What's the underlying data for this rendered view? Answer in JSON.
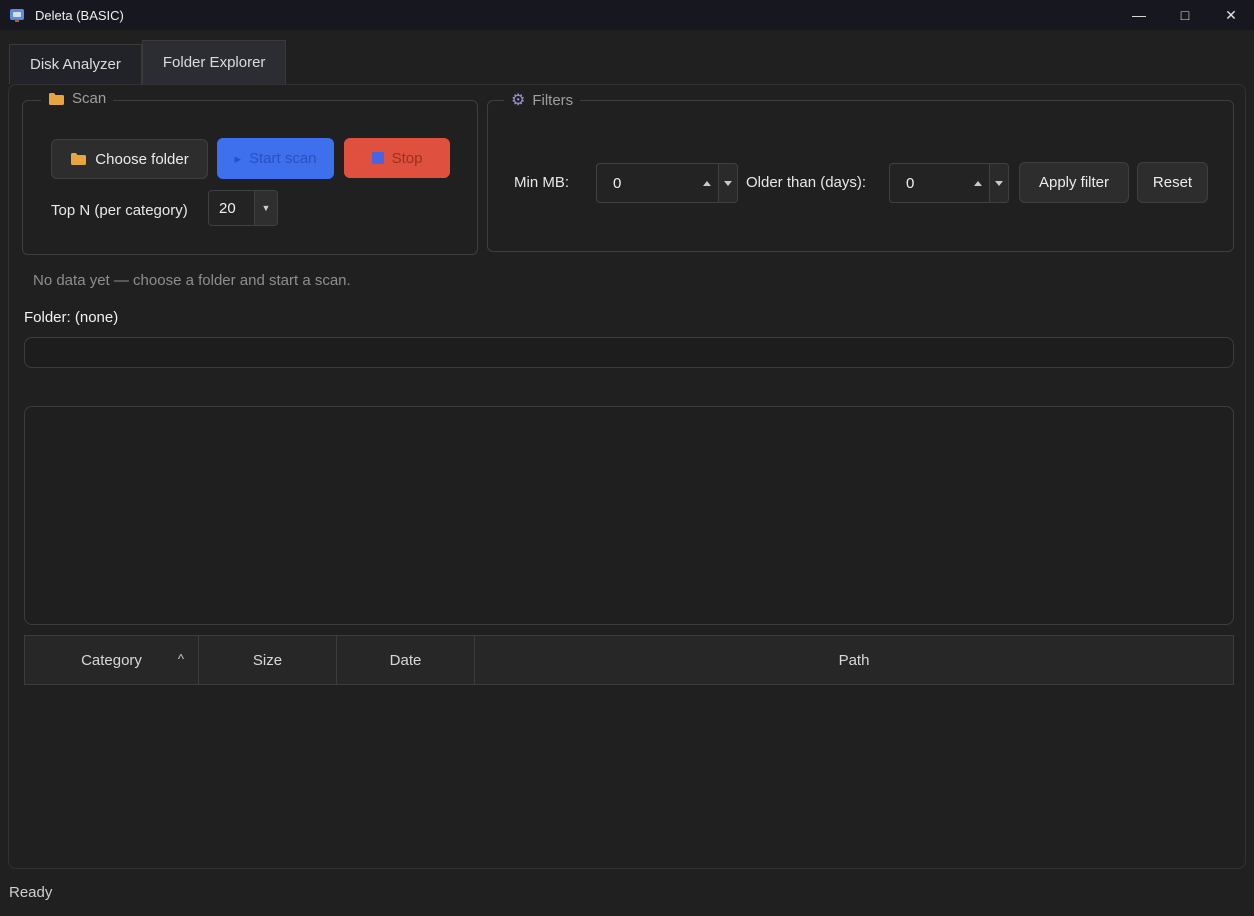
{
  "window": {
    "title": "Deleta (BASIC)",
    "minimize_glyph": "—",
    "maximize_glyph": "□",
    "close_glyph": "✕"
  },
  "tabs": {
    "items": [
      {
        "label": "Disk Analyzer",
        "selected": false
      },
      {
        "label": "Folder Explorer",
        "selected": true
      }
    ]
  },
  "scan": {
    "legend": "Scan",
    "choose_folder": "Choose folder",
    "start_scan": "Start scan",
    "stop": "Stop",
    "top_n_label": "Top N (per category)",
    "top_n_value": "20"
  },
  "filters": {
    "legend": "Filters",
    "min_mb_label": "Min MB:",
    "min_mb_value": "0",
    "older_days_label": "Older than (days):",
    "older_days_value": "0",
    "apply": "Apply filter",
    "reset": "Reset"
  },
  "messages": {
    "no_data": "No data yet — choose a folder and start a scan.",
    "folder": "Folder: (none)"
  },
  "folder_input": {
    "value": ""
  },
  "table": {
    "columns": [
      "Category",
      "Size",
      "Date",
      "Path"
    ],
    "sort_column": "Category",
    "sort_glyph": "^",
    "rows": []
  },
  "statusbar": {
    "text": "Ready"
  },
  "icons": {
    "play_glyph": "▸",
    "dropdown_glyph": "▼",
    "gear_glyph": "⚙"
  },
  "colors": {
    "start_button_bg": "#3e70ee",
    "stop_button_bg": "#e0503f",
    "stop_icon_blue": "#4565e2",
    "folder_icon_orange": "#e8a43e",
    "gear_icon_purple": "#9a90d6",
    "titlebar_bg": "#17171f",
    "window_bg": "#202020"
  }
}
